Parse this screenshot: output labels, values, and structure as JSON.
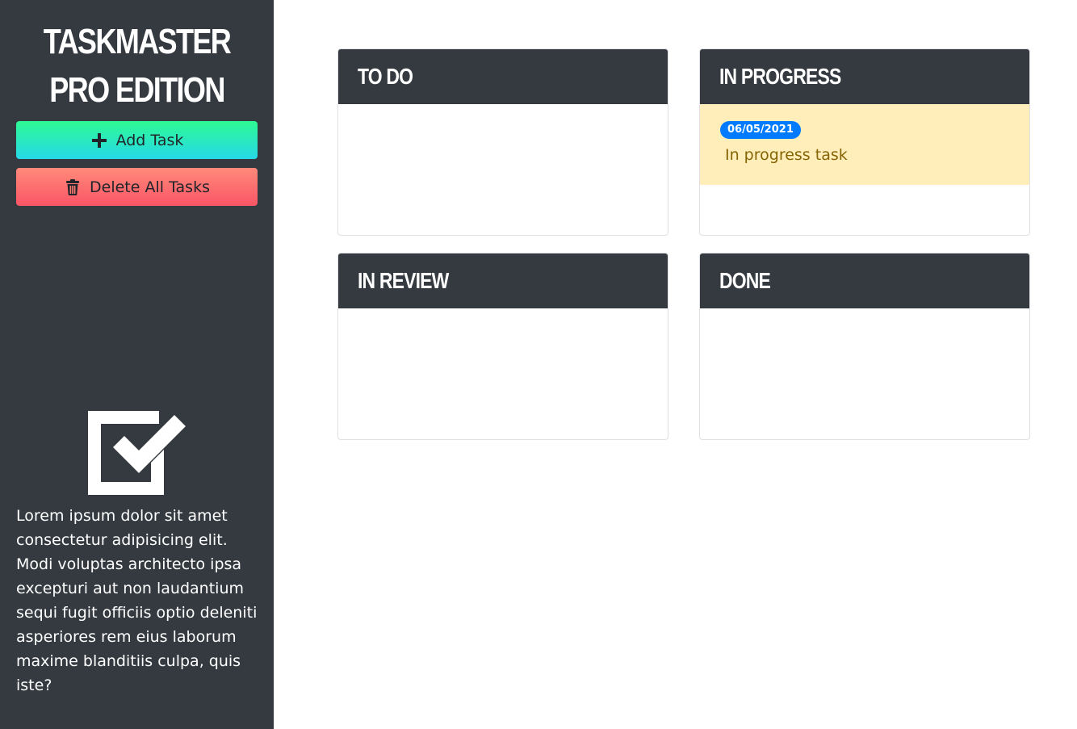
{
  "sidebar": {
    "title": "TASKMASTER PRO EDITION",
    "add_task_label": "Add Task",
    "delete_all_label": "Delete All Tasks",
    "description": "Lorem ipsum dolor sit amet consectetur adipisicing elit. Modi voluptas architecto ipsa excepturi aut non laudantium sequi fugit officiis optio deleniti asperiores rem eius laborum maxime blanditiis culpa, quis iste?",
    "icons": {
      "add": "plus-icon",
      "delete": "trash-icon",
      "hero": "checkbox-checked-icon"
    }
  },
  "board": {
    "columns": [
      {
        "title": "TO DO",
        "tasks": []
      },
      {
        "title": "IN PROGRESS",
        "tasks": [
          {
            "date": "06/05/2021",
            "text": "In progress task"
          }
        ]
      },
      {
        "title": "IN REVIEW",
        "tasks": []
      },
      {
        "title": "DONE",
        "tasks": []
      }
    ]
  },
  "colors": {
    "sidebar_bg": "#343a40",
    "add_gradient": [
      "#2ef994",
      "#26d9e8"
    ],
    "delete_gradient": [
      "#ff8a7a",
      "#fa5566"
    ],
    "task_bg": "#ffeeba",
    "badge_bg": "#007bff"
  }
}
